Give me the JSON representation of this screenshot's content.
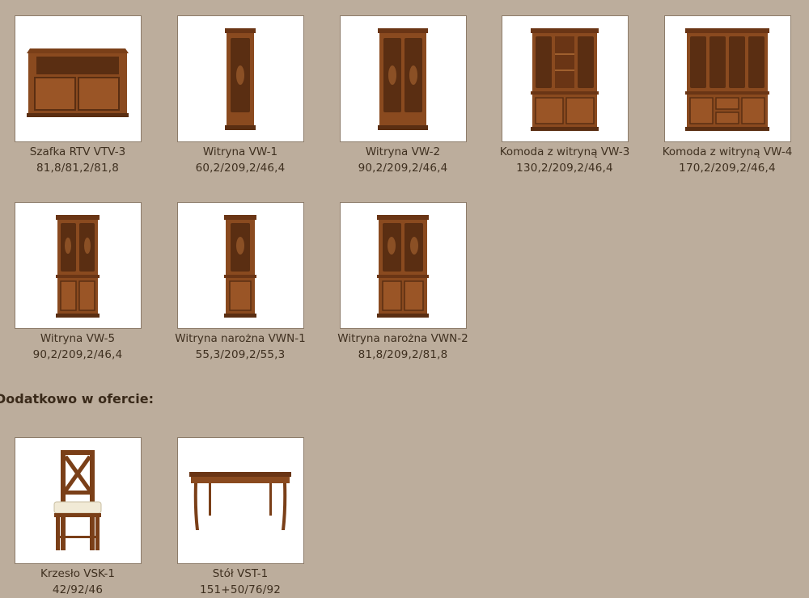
{
  "products": [
    {
      "name": "Szafka RTV VTV-3",
      "dims": "81,8/81,2/81,8",
      "image": "corner-tv-cabinet"
    },
    {
      "name": "Witryna VW-1",
      "dims": "60,2/209,2/46,4",
      "image": "narrow-display-cabinet"
    },
    {
      "name": "Witryna VW-2",
      "dims": "90,2/209,2/46,4",
      "image": "double-display-cabinet"
    },
    {
      "name": "Komoda z witryną VW-3",
      "dims": "130,2/209,2/46,4",
      "image": "sideboard-with-display"
    },
    {
      "name": "Komoda z witryną VW-4",
      "dims": "170,2/209,2/46,4",
      "image": "wide-sideboard-with-display"
    },
    {
      "name": "Witryna VW-5",
      "dims": "90,2/209,2/46,4",
      "image": "display-cabinet-with-doors"
    },
    {
      "name": "Witryna narożna VWN-1",
      "dims": "55,3/209,2/55,3",
      "image": "corner-display-cabinet"
    },
    {
      "name": "Witryna narożna VWN-2",
      "dims": "81,8/209,2/81,8",
      "image": "wide-corner-display-cabinet"
    }
  ],
  "extras_heading": "Dodatkowo w ofercie:",
  "extras": [
    {
      "name": "Krzesło VSK-1",
      "dims": "42/92/46",
      "image": "chair"
    },
    {
      "name": "Stół VST-1",
      "dims": "151+50/76/92",
      "image": "dining-table"
    }
  ],
  "colors": {
    "background": "#bcad9c",
    "wood": "#8a4a1f",
    "wood_dark": "#5a2e12",
    "text": "#3f3020"
  }
}
